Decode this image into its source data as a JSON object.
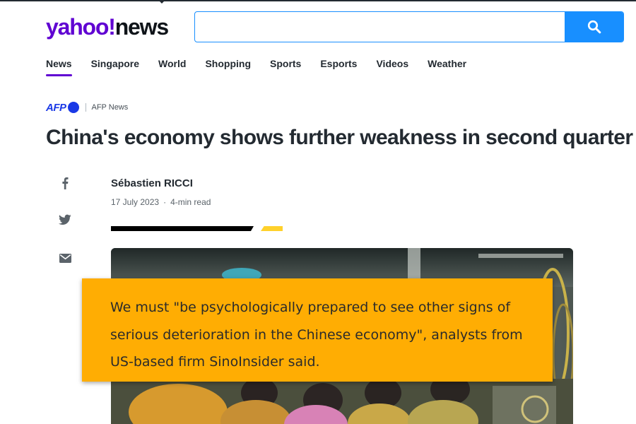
{
  "header": {
    "logo_yahoo": "yahoo!",
    "logo_news": "news",
    "search": {
      "placeholder": "",
      "value": ""
    }
  },
  "nav": {
    "items": [
      {
        "label": "News",
        "active": true
      },
      {
        "label": "Singapore",
        "active": false
      },
      {
        "label": "World",
        "active": false
      },
      {
        "label": "Shopping",
        "active": false
      },
      {
        "label": "Sports",
        "active": false
      },
      {
        "label": "Esports",
        "active": false
      },
      {
        "label": "Videos",
        "active": false
      },
      {
        "label": "Weather",
        "active": false
      }
    ]
  },
  "article": {
    "provider_logo": "AFP",
    "provider_name": "AFP News",
    "title": "China's economy shows further weakness in second quarter",
    "author": "Sébastien RICCI",
    "date": "17 July 2023",
    "read_time": "4-min read",
    "share_icons": [
      "facebook-icon",
      "twitter-icon",
      "mail-icon"
    ]
  },
  "callout": {
    "text": "We must \"be psychologically prepared to see other signs of serious deterioration in the Chinese economy\", analysts from US-based firm SinoInsider said."
  },
  "colors": {
    "brand_purple": "#6001d2",
    "search_blue": "#188fff",
    "afp_blue": "#1a39e6",
    "callout_orange": "#ffad03",
    "accent_yellow": "#ffd12b"
  }
}
